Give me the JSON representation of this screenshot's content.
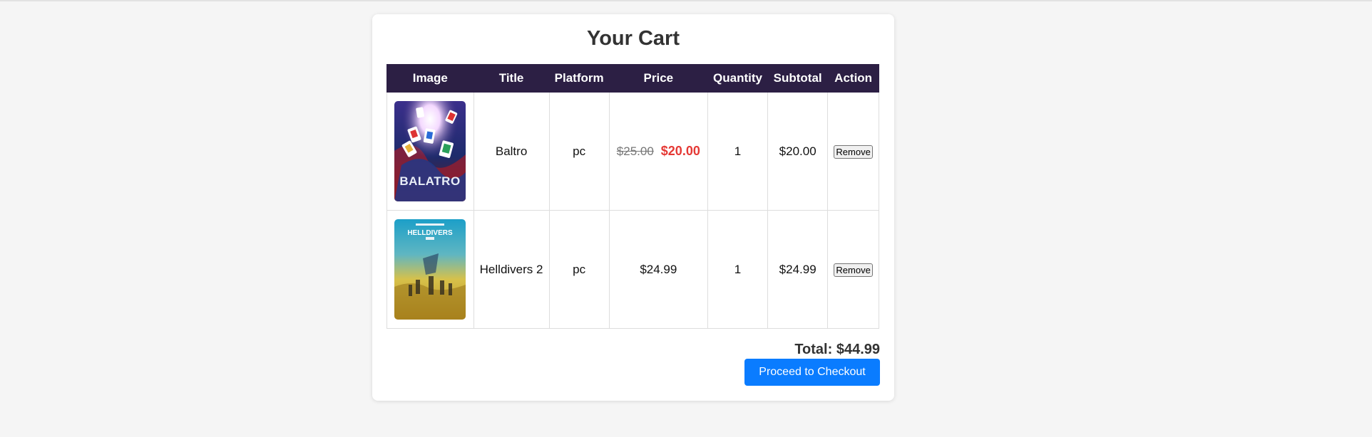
{
  "cart": {
    "title": "Your Cart",
    "columns": [
      "Image",
      "Title",
      "Platform",
      "Price",
      "Quantity",
      "Subtotal",
      "Action"
    ],
    "items": [
      {
        "title": "Baltro",
        "platform": "pc",
        "original_price": "$25.00",
        "sale_price": "$20.00",
        "quantity": "1",
        "subtotal": "$20.00",
        "action_label": "Remove",
        "cover_text": "BALATRO"
      },
      {
        "title": "Helldivers 2",
        "platform": "pc",
        "price": "$24.99",
        "quantity": "1",
        "subtotal": "$24.99",
        "action_label": "Remove",
        "cover_text": "HELLDIVERS"
      }
    ],
    "total_label": "Total: $44.99",
    "checkout_label": "Proceed to Checkout"
  },
  "colors": {
    "header_bg": "#2c1f44",
    "sale_red": "#e53935",
    "checkout_blue": "#0a7cff"
  }
}
